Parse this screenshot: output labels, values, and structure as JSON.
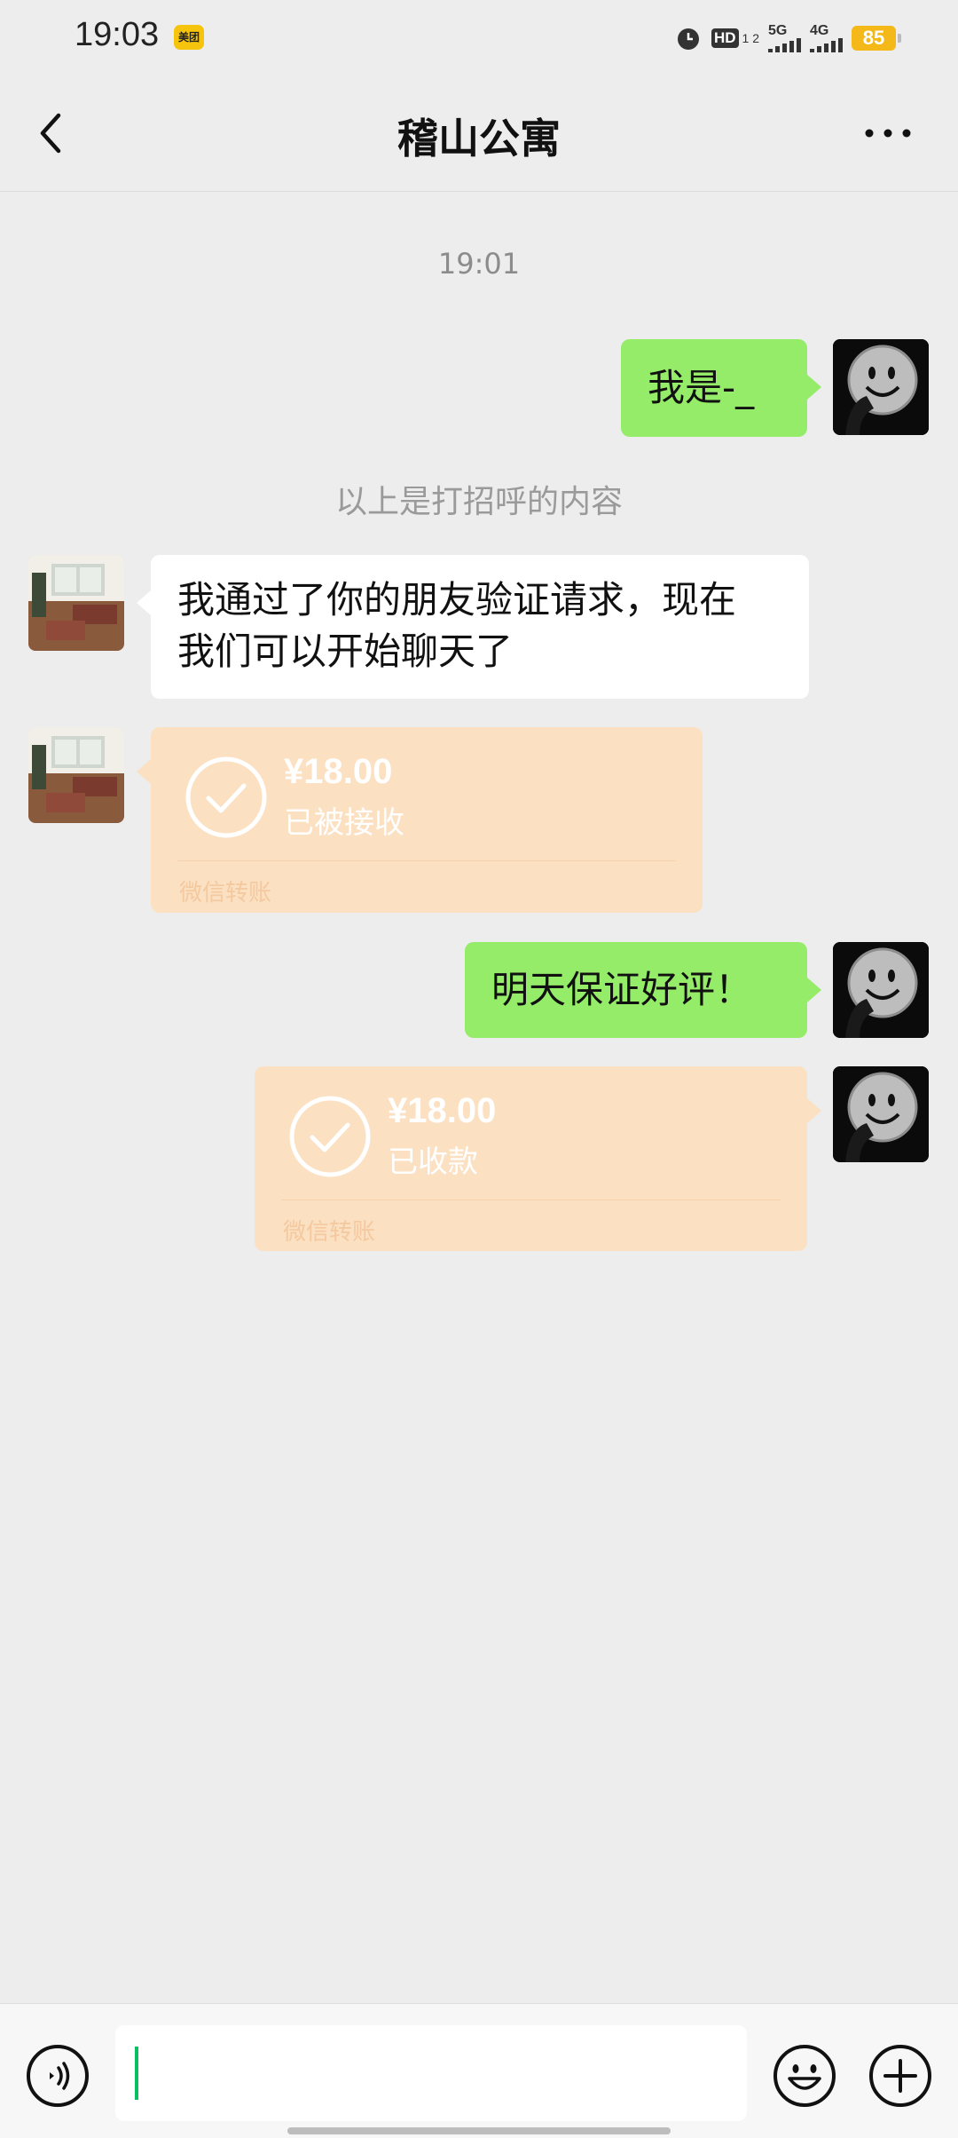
{
  "status_bar": {
    "time": "19:03",
    "app_badge": "美团",
    "hd_label": "HD",
    "hd_sub": "1 2",
    "net1": "5G",
    "net2": "4G",
    "battery": "85"
  },
  "header": {
    "title": "稽山公寓",
    "back_icon": "chevron-left-icon",
    "more_icon": "ellipsis-icon"
  },
  "chat": {
    "timestamp": "19:01",
    "messages": [
      {
        "sender": "self",
        "text": "我是-_"
      },
      {
        "type": "system",
        "text": "以上是打招呼的内容"
      },
      {
        "sender": "other",
        "text_line1": "我通过了你的朋友验证请求，现在",
        "text_line2": "我们可以开始聊天了"
      },
      {
        "sender": "other",
        "type": "transfer",
        "amount": "¥18.00",
        "status": "已被接收",
        "label": "微信转账"
      },
      {
        "sender": "self",
        "text": "明天保证好评！"
      },
      {
        "sender": "self",
        "type": "transfer",
        "amount": "¥18.00",
        "status": "已收款",
        "label": "微信转账"
      }
    ]
  },
  "input_bar": {
    "voice_icon": "voice-icon",
    "placeholder": "",
    "emoji_icon": "emoji-icon",
    "plus_icon": "plus-icon"
  },
  "colors": {
    "background": "#ededed",
    "self_bubble": "#95ec69",
    "other_bubble": "#ffffff",
    "transfer_bubble": "#fbe0c2",
    "accent": "#07c160"
  }
}
